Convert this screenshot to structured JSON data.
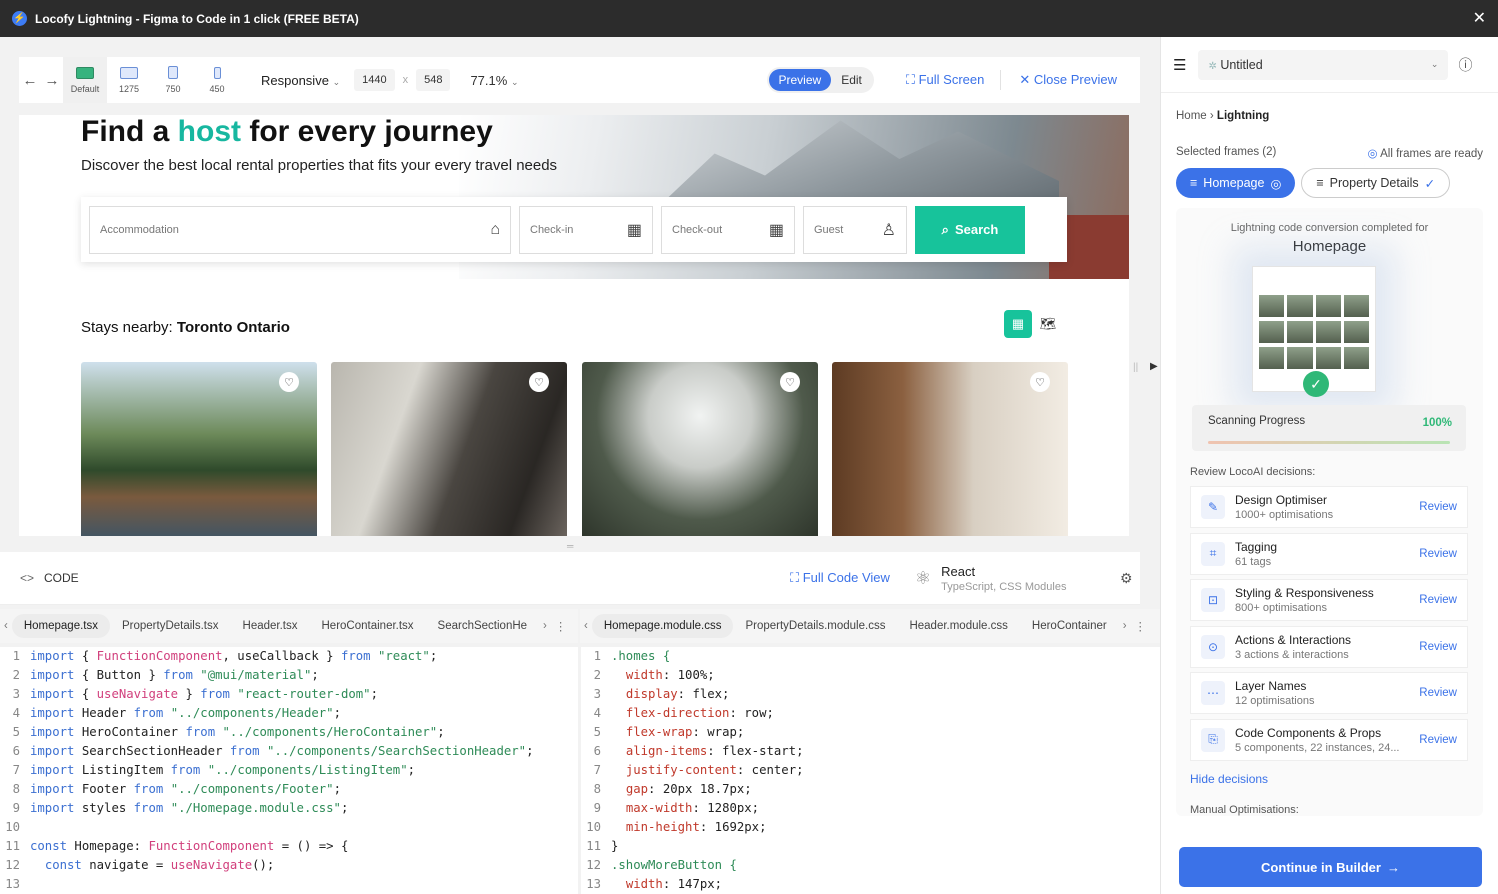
{
  "window": {
    "title": "Locofy Lightning - Figma to Code in 1 click (FREE BETA)"
  },
  "toolbar": {
    "devices": [
      {
        "label": "Default"
      },
      {
        "label": "1275"
      },
      {
        "label": "750"
      },
      {
        "label": "450"
      }
    ],
    "responsive_label": "Responsive",
    "width_value": "1440",
    "height_value": "548",
    "x_sep": "x",
    "zoom": "77.1%",
    "preview_label": "Preview",
    "edit_label": "Edit",
    "fullscreen_label": "Full Screen",
    "close_preview_label": "Close Preview"
  },
  "preview": {
    "title_pre": "Find a ",
    "title_hl": "host",
    "title_post": " for every journey",
    "subtitle": "Discover the best local rental properties that fits your every travel needs",
    "search": {
      "accommodation": "Accommodation",
      "checkin": "Check-in",
      "checkout": "Check-out",
      "guest": "Guest",
      "button": "Search"
    },
    "stays_prefix": "Stays nearby: ",
    "stays_location": "Toronto Ontario"
  },
  "code_header": {
    "label": "CODE",
    "full_code_view": "Full Code View",
    "framework": "React",
    "framework_sub": "TypeScript, CSS Modules"
  },
  "tabs_left": [
    "Homepage.tsx",
    "PropertyDetails.tsx",
    "Header.tsx",
    "HeroContainer.tsx",
    "SearchSectionHe"
  ],
  "tabs_right": [
    "Homepage.module.css",
    "PropertyDetails.module.css",
    "Header.module.css",
    "HeroContainer"
  ],
  "code_left": [
    "import { FunctionComponent, useCallback } from \"react\";",
    "import { Button } from \"@mui/material\";",
    "import { useNavigate } from \"react-router-dom\";",
    "import Header from \"../components/Header\";",
    "import HeroContainer from \"../components/HeroContainer\";",
    "import SearchSectionHeader from \"../components/SearchSectionHeader\";",
    "import ListingItem from \"../components/ListingItem\";",
    "import Footer from \"../components/Footer\";",
    "import styles from \"./Homepage.module.css\";",
    "",
    "const Homepage: FunctionComponent = () => {",
    "  const navigate = useNavigate();",
    ""
  ],
  "code_right": [
    ".homes {",
    "  width: 100%;",
    "  display: flex;",
    "  flex-direction: row;",
    "  flex-wrap: wrap;",
    "  align-items: flex-start;",
    "  justify-content: center;",
    "  gap: 20px 18.7px;",
    "  max-width: 1280px;",
    "  min-height: 1692px;",
    "}",
    ".showMoreButton {",
    "  width: 147px;"
  ],
  "right": {
    "project": "Untitled",
    "breadcrumb_home": "Home",
    "breadcrumb_current": "Lightning",
    "selected_frames": "Selected frames (2)",
    "frames_ready": "All frames are ready",
    "frame1": "Homepage",
    "frame2": "Property Details",
    "completed_label": "Lightning code conversion completed for",
    "completed_frame": "Homepage",
    "scanning_label": "Scanning Progress",
    "scanning_pct": "100%",
    "scanning_value": 1.0,
    "review_label": "Review LocoAI decisions:",
    "decisions": [
      {
        "title": "Design Optimiser",
        "sub": "1000+ optimisations",
        "action": "Review"
      },
      {
        "title": "Tagging",
        "sub": "61 tags",
        "action": "Review"
      },
      {
        "title": "Styling & Responsiveness",
        "sub": "800+ optimisations",
        "action": "Review"
      },
      {
        "title": "Actions & Interactions",
        "sub": "3 actions & interactions",
        "action": "Review"
      },
      {
        "title": "Layer Names",
        "sub": "12 optimisations",
        "action": "Review"
      },
      {
        "title": "Code Components & Props",
        "sub": "5 components, 22 instances, 24...",
        "action": "Review"
      }
    ],
    "hide_decisions": "Hide decisions",
    "manual_label": "Manual Optimisations:",
    "continue": "Continue in Builder"
  },
  "colors": {
    "accent": "#3b72e8",
    "brand_green": "#17c39b",
    "host_highlight": "#17b7a0"
  }
}
